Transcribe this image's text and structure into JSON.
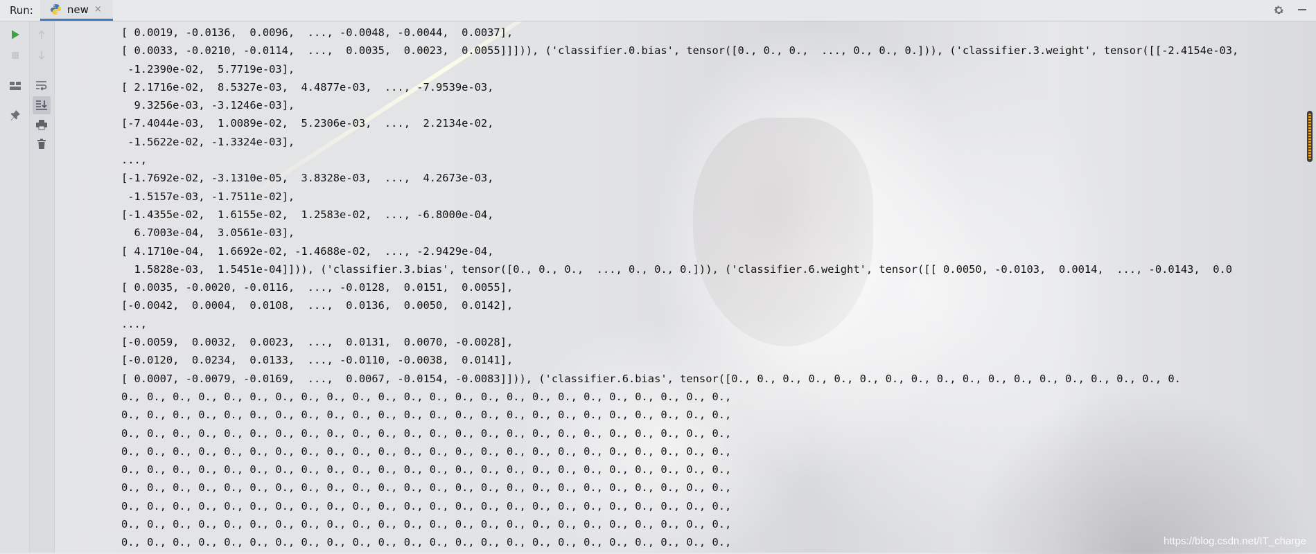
{
  "runbar": {
    "label": "Run:",
    "tab_name": "new",
    "tab_close": "×"
  },
  "console_lines": [
    "[ 0.0019, -0.0136,  0.0096,  ..., -0.0048, -0.0044,  0.0037],",
    "[ 0.0033, -0.0210, -0.0114,  ...,  0.0035,  0.0023,  0.0055]]])), ('classifier.0.bias', tensor([0., 0., 0.,  ..., 0., 0., 0.])), ('classifier.3.weight', tensor([[-2.4154e-03,",
    " -1.2390e-02,  5.7719e-03],",
    "[ 2.1716e-02,  8.5327e-03,  4.4877e-03,  ..., -7.9539e-03,",
    "  9.3256e-03, -3.1246e-03],",
    "[-7.4044e-03,  1.0089e-02,  5.2306e-03,  ...,  2.2134e-02,",
    " -1.5622e-02, -1.3324e-03],",
    "...,",
    "[-1.7692e-02, -3.1310e-05,  3.8328e-03,  ...,  4.2673e-03,",
    " -1.5157e-03, -1.7511e-02],",
    "[-1.4355e-02,  1.6155e-02,  1.2583e-02,  ..., -6.8000e-04,",
    "  6.7003e-04,  3.0561e-03],",
    "[ 4.1710e-04,  1.6692e-02, -1.4688e-02,  ..., -2.9429e-04,",
    "  1.5828e-03,  1.5451e-04]])), ('classifier.3.bias', tensor([0., 0., 0.,  ..., 0., 0., 0.])), ('classifier.6.weight', tensor([[ 0.0050, -0.0103,  0.0014,  ..., -0.0143,  0.0",
    "[ 0.0035, -0.0020, -0.0116,  ..., -0.0128,  0.0151,  0.0055],",
    "[-0.0042,  0.0004,  0.0108,  ...,  0.0136,  0.0050,  0.0142],",
    "...,",
    "[-0.0059,  0.0032,  0.0023,  ...,  0.0131,  0.0070, -0.0028],",
    "[-0.0120,  0.0234,  0.0133,  ..., -0.0110, -0.0038,  0.0141],",
    "[ 0.0007, -0.0079, -0.0169,  ...,  0.0067, -0.0154, -0.0083]])), ('classifier.6.bias', tensor([0., 0., 0., 0., 0., 0., 0., 0., 0., 0., 0., 0., 0., 0., 0., 0., 0., 0.",
    "0., 0., 0., 0., 0., 0., 0., 0., 0., 0., 0., 0., 0., 0., 0., 0., 0., 0., 0., 0., 0., 0., 0., 0.,",
    "0., 0., 0., 0., 0., 0., 0., 0., 0., 0., 0., 0., 0., 0., 0., 0., 0., 0., 0., 0., 0., 0., 0., 0.,",
    "0., 0., 0., 0., 0., 0., 0., 0., 0., 0., 0., 0., 0., 0., 0., 0., 0., 0., 0., 0., 0., 0., 0., 0.,",
    "0., 0., 0., 0., 0., 0., 0., 0., 0., 0., 0., 0., 0., 0., 0., 0., 0., 0., 0., 0., 0., 0., 0., 0.,",
    "0., 0., 0., 0., 0., 0., 0., 0., 0., 0., 0., 0., 0., 0., 0., 0., 0., 0., 0., 0., 0., 0., 0., 0.,",
    "0., 0., 0., 0., 0., 0., 0., 0., 0., 0., 0., 0., 0., 0., 0., 0., 0., 0., 0., 0., 0., 0., 0., 0.,",
    "0., 0., 0., 0., 0., 0., 0., 0., 0., 0., 0., 0., 0., 0., 0., 0., 0., 0., 0., 0., 0., 0., 0., 0.,",
    "0., 0., 0., 0., 0., 0., 0., 0., 0., 0., 0., 0., 0., 0., 0., 0., 0., 0., 0., 0., 0., 0., 0., 0.,",
    "0., 0., 0., 0., 0., 0., 0., 0., 0., 0., 0., 0., 0., 0., 0., 0., 0., 0., 0., 0., 0., 0., 0., 0.,"
  ],
  "watermark": "https://blog.csdn.net/IT_charge",
  "icons": {
    "rerun": "play-icon",
    "stop": "stop-icon",
    "up": "arrow-up-icon",
    "down": "arrow-down-icon",
    "layout": "layout-icon",
    "wrap": "soft-wrap-icon",
    "scroll_end": "scroll-to-end-icon",
    "pin": "pin-icon",
    "print": "print-icon",
    "clear": "trash-icon",
    "settings": "gear-icon",
    "minimize": "minimize-icon"
  },
  "colors": {
    "accent_tab": "#3d7ac8",
    "run_green": "#3fa243",
    "console_text": "#111111",
    "scroll_marker": "#f3a41b"
  }
}
